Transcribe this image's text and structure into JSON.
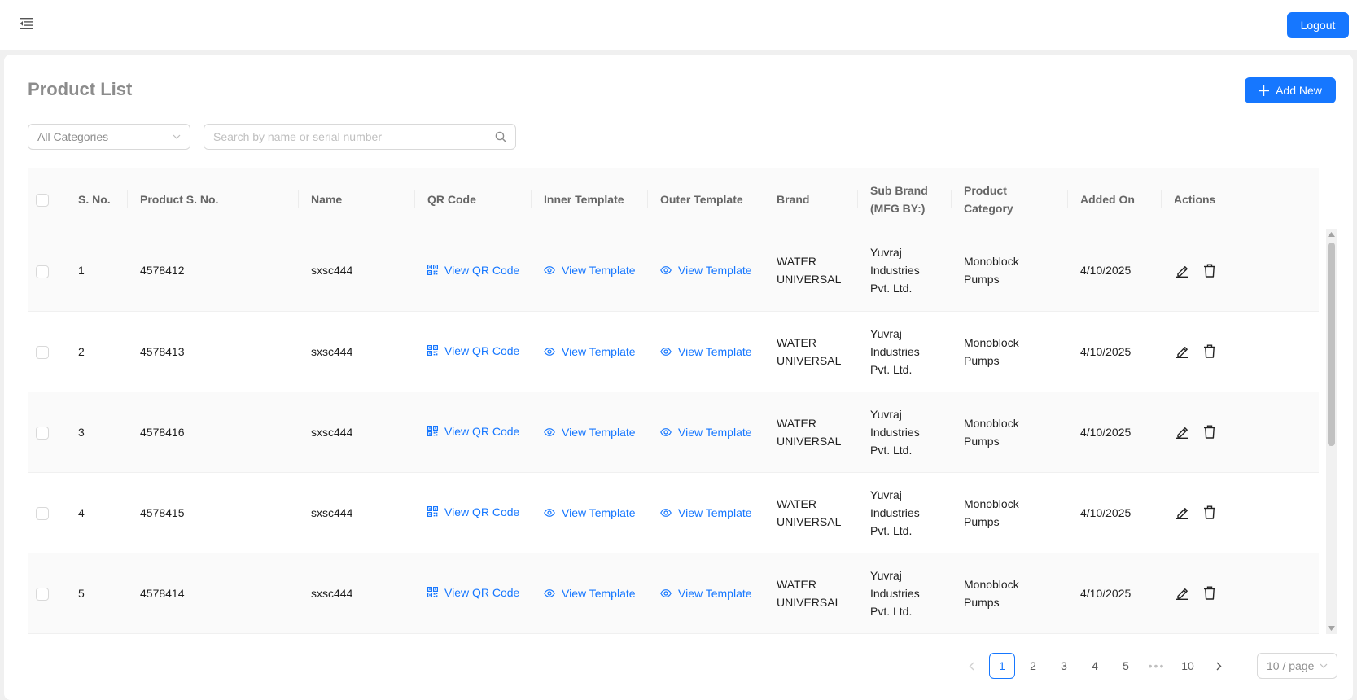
{
  "header": {
    "menu_icon": "menu-fold-icon",
    "logout_label": "Logout"
  },
  "page": {
    "title": "Product List",
    "add_new_label": "Add New"
  },
  "filters": {
    "category_value": "All Categories",
    "search_placeholder": "Search by name or serial number"
  },
  "table": {
    "columns": [
      "S. No.",
      "Product S. No.",
      "Name",
      "QR Code",
      "Inner Template",
      "Outer Template",
      "Brand",
      "Sub Brand (MFG BY:)",
      "Product Category",
      "Added On",
      "Actions"
    ],
    "rows": [
      {
        "sno": "1",
        "product_sno": "4578412",
        "name": "sxsc444",
        "qr": "View QR Code",
        "inner": "View Template",
        "outer": "View Template",
        "brand": "WATER UNIVERSAL",
        "sub_brand": "Yuvraj Industries Pvt. Ltd.",
        "category": "Monoblock Pumps",
        "added_on": "4/10/2025"
      },
      {
        "sno": "2",
        "product_sno": "4578413",
        "name": "sxsc444",
        "qr": "View QR Code",
        "inner": "View Template",
        "outer": "View Template",
        "brand": "WATER UNIVERSAL",
        "sub_brand": "Yuvraj Industries Pvt. Ltd.",
        "category": "Monoblock Pumps",
        "added_on": "4/10/2025"
      },
      {
        "sno": "3",
        "product_sno": "4578416",
        "name": "sxsc444",
        "qr": "View QR Code",
        "inner": "View Template",
        "outer": "View Template",
        "brand": "WATER UNIVERSAL",
        "sub_brand": "Yuvraj Industries Pvt. Ltd.",
        "category": "Monoblock Pumps",
        "added_on": "4/10/2025"
      },
      {
        "sno": "4",
        "product_sno": "4578415",
        "name": "sxsc444",
        "qr": "View QR Code",
        "inner": "View Template",
        "outer": "View Template",
        "brand": "WATER UNIVERSAL",
        "sub_brand": "Yuvraj Industries Pvt. Ltd.",
        "category": "Monoblock Pumps",
        "added_on": "4/10/2025"
      },
      {
        "sno": "5",
        "product_sno": "4578414",
        "name": "sxsc444",
        "qr": "View QR Code",
        "inner": "View Template",
        "outer": "View Template",
        "brand": "WATER UNIVERSAL",
        "sub_brand": "Yuvraj Industries Pvt. Ltd.",
        "category": "Monoblock Pumps",
        "added_on": "4/10/2025"
      }
    ]
  },
  "pagination": {
    "prev_icon": "chevron-left-icon",
    "pages": [
      "1",
      "2",
      "3",
      "4",
      "5"
    ],
    "ellipsis": "•••",
    "last_page": "10",
    "current": "1",
    "next_icon": "chevron-right-icon",
    "page_size": "10 / page"
  },
  "colors": {
    "primary": "#1677ff",
    "title": "#8c8c8c",
    "header_bg": "#fafafa"
  }
}
